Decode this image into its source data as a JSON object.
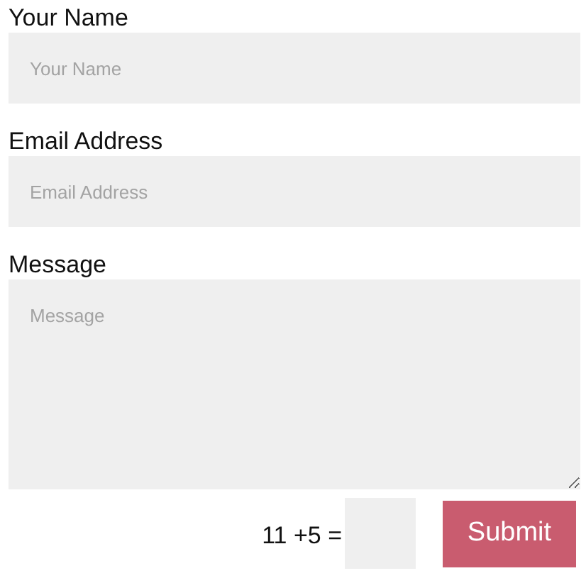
{
  "fields": [
    {
      "kind": "input",
      "label": "Your Name",
      "placeholder": "Your Name"
    },
    {
      "kind": "input",
      "label": "Email Address",
      "placeholder": "Email Address"
    },
    {
      "kind": "textarea",
      "label": "Message",
      "placeholder": "Message"
    }
  ],
  "captcha": {
    "question": "11 +5 ="
  },
  "submit": {
    "label": "Submit"
  }
}
